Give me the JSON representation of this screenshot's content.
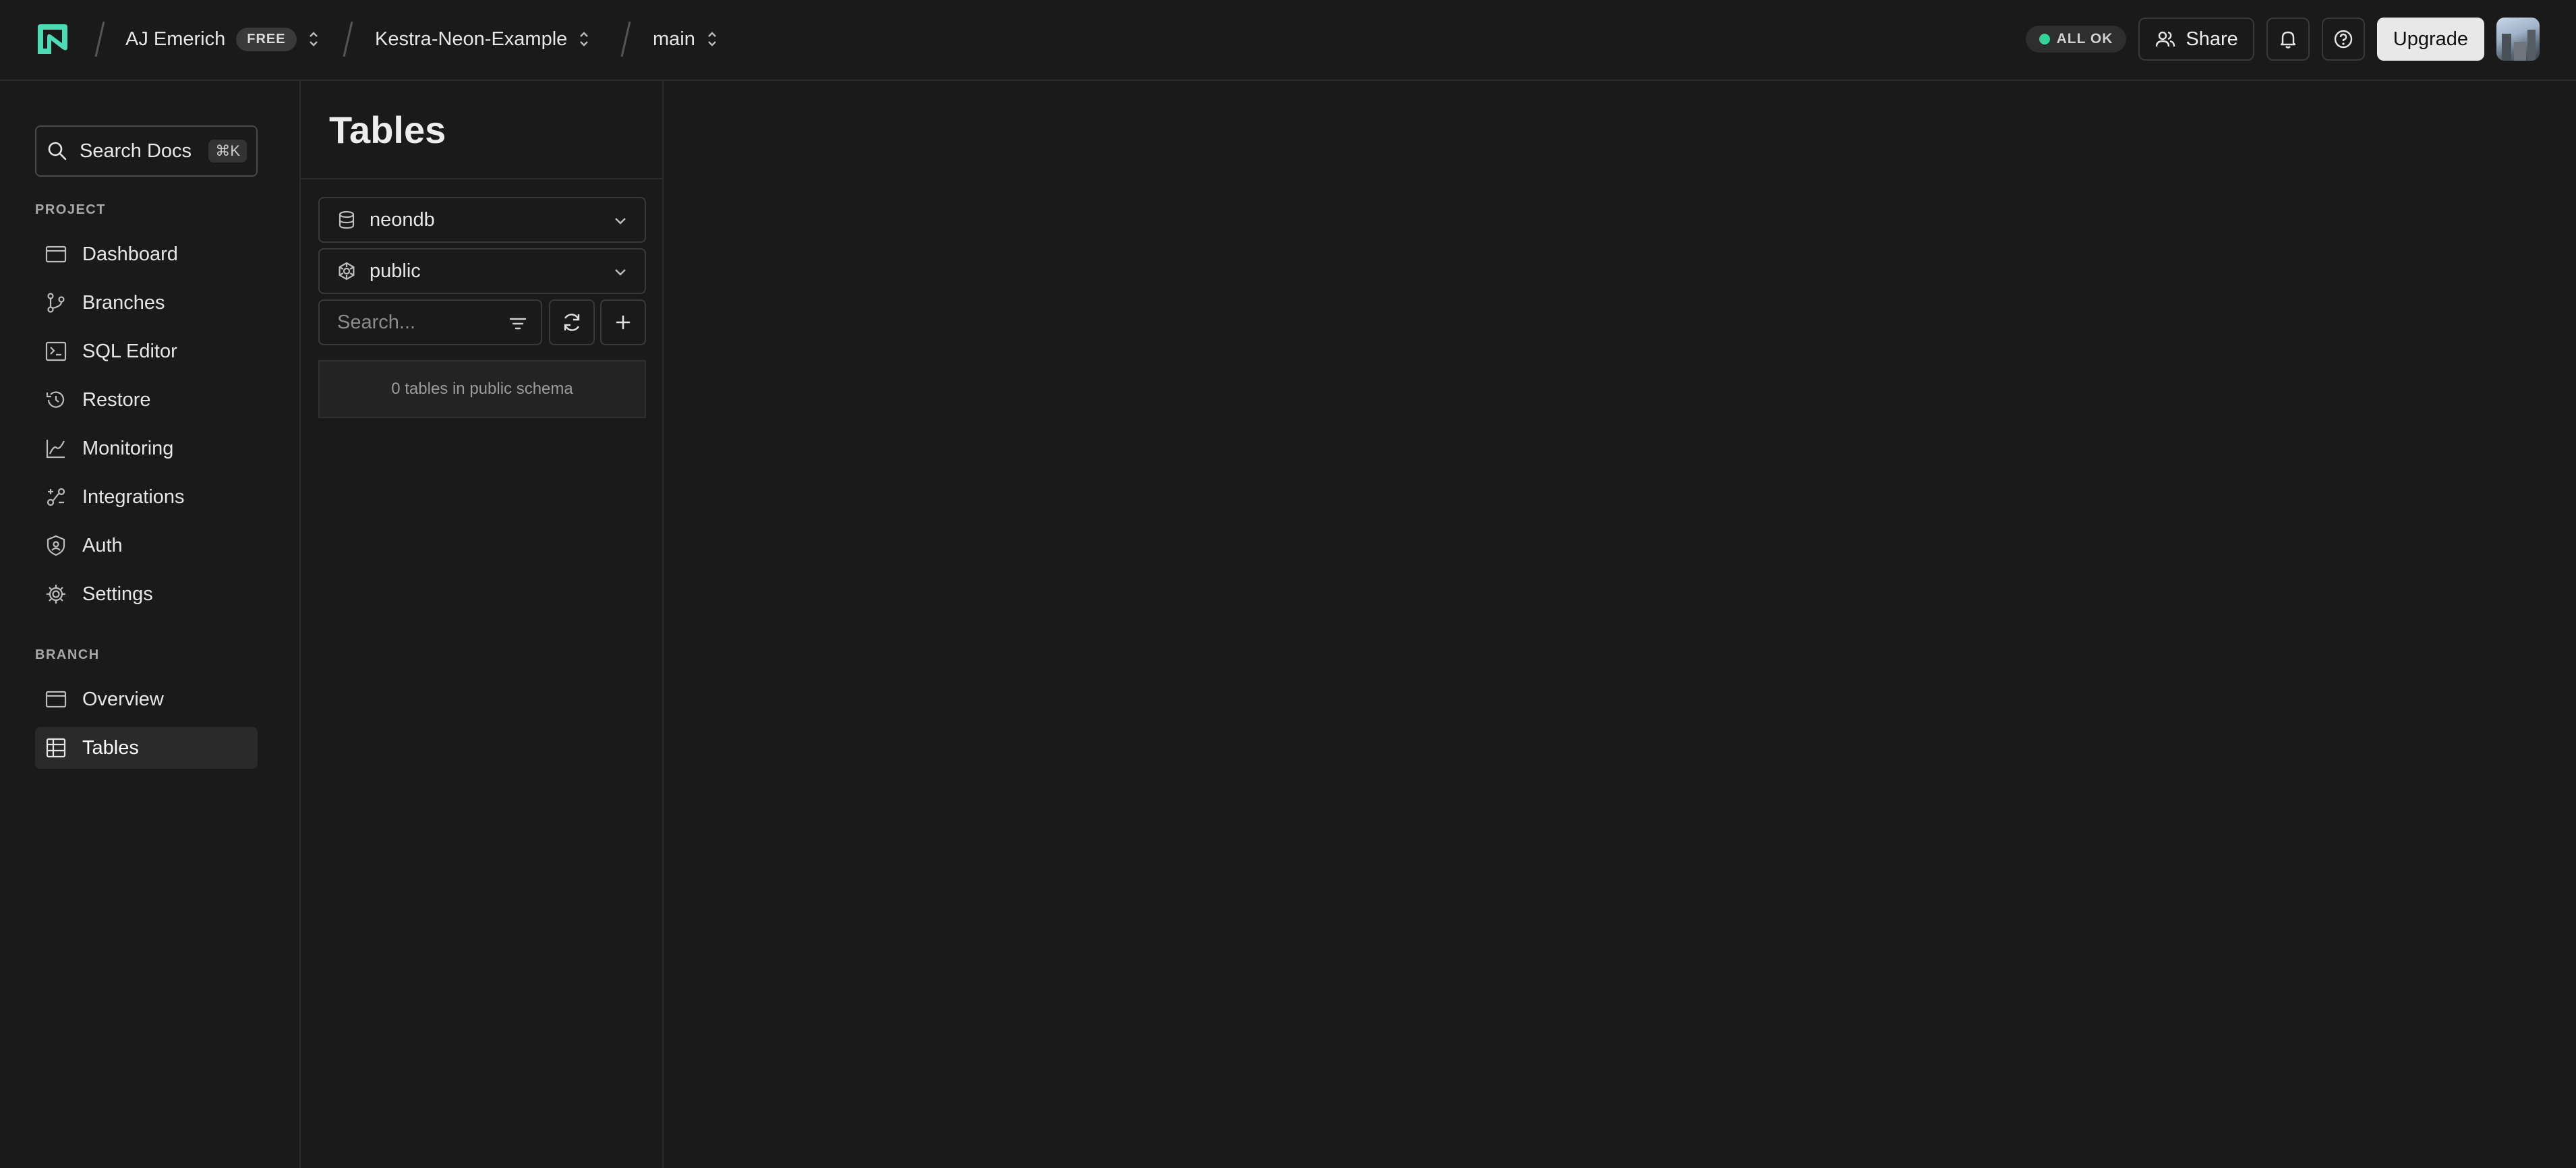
{
  "topbar": {
    "org_name": "AJ Emerich",
    "org_plan": "FREE",
    "project_name": "Kestra-Neon-Example",
    "branch_name": "main",
    "status_text": "ALL OK",
    "share_label": "Share",
    "upgrade_label": "Upgrade"
  },
  "sidebar": {
    "search_label": "Search Docs",
    "search_shortcut": "⌘K",
    "project_section": "PROJECT",
    "project_items": [
      {
        "label": "Dashboard",
        "icon": "dashboard-icon"
      },
      {
        "label": "Branches",
        "icon": "branches-icon"
      },
      {
        "label": "SQL Editor",
        "icon": "sql-editor-icon"
      },
      {
        "label": "Restore",
        "icon": "restore-icon"
      },
      {
        "label": "Monitoring",
        "icon": "monitoring-icon"
      },
      {
        "label": "Integrations",
        "icon": "integrations-icon"
      },
      {
        "label": "Auth",
        "icon": "auth-icon"
      },
      {
        "label": "Settings",
        "icon": "settings-icon"
      }
    ],
    "branch_section": "BRANCH",
    "branch_items": [
      {
        "label": "Overview",
        "icon": "overview-icon"
      },
      {
        "label": "Tables",
        "icon": "tables-icon",
        "active": true
      }
    ]
  },
  "tables_panel": {
    "title": "Tables",
    "database_select": "neondb",
    "schema_select": "public",
    "search_placeholder": "Search...",
    "empty_message": "0 tables in public schema"
  },
  "colors": {
    "background": "#1a1a1a",
    "accent_green": "#34d399",
    "logo": "#4ddbb5"
  }
}
